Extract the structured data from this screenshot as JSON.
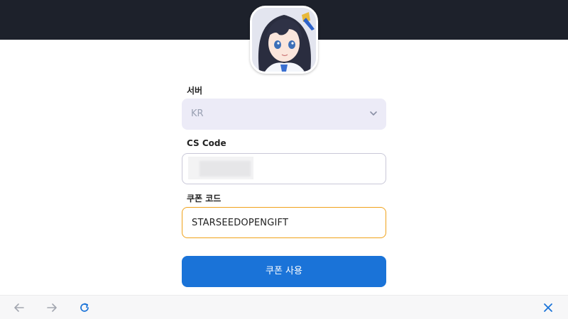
{
  "form": {
    "server_label": "서버",
    "server_value": "KR",
    "cs_label": "CS Code",
    "cs_value": "",
    "coupon_label": "쿠폰 코드",
    "coupon_value": "STARSEEDOPENGIFT",
    "submit_label": "쿠폰 사용"
  },
  "colors": {
    "header_bg": "#1d212b",
    "button_bg": "#1a73d8",
    "focus_border": "#f0a21a"
  },
  "icons": {
    "back": "arrow-left-icon",
    "forward": "arrow-right-icon",
    "reload": "reload-icon",
    "close": "close-icon"
  }
}
